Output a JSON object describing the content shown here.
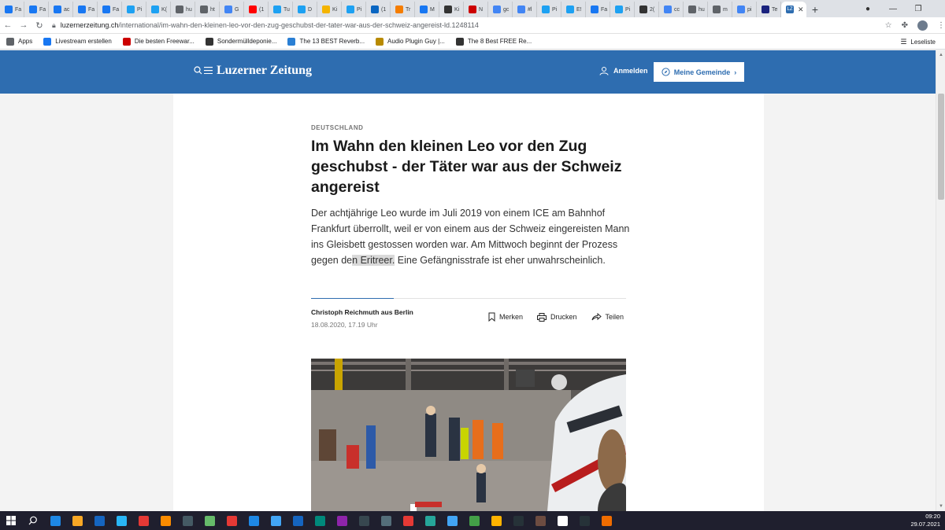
{
  "browser": {
    "tabs": [
      {
        "label": "Fa",
        "icon": "facebook-icon",
        "color": "#1877f2"
      },
      {
        "label": "Fa",
        "icon": "facebook-icon",
        "color": "#1877f2"
      },
      {
        "label": "ac",
        "icon": "facebook-icon",
        "color": "#1877f2"
      },
      {
        "label": "Fa",
        "icon": "facebook-icon",
        "color": "#1877f2"
      },
      {
        "label": "Fa",
        "icon": "facebook-icon",
        "color": "#1877f2"
      },
      {
        "label": "Pi",
        "icon": "twitter-icon",
        "color": "#1da1f2"
      },
      {
        "label": "K(",
        "icon": "twitter-icon",
        "color": "#1da1f2"
      },
      {
        "label": "hu",
        "icon": "globe-icon",
        "color": "#5f6368"
      },
      {
        "label": "ht",
        "icon": "globe-icon",
        "color": "#5f6368"
      },
      {
        "label": "G",
        "icon": "translate-icon",
        "color": "#4285f4"
      },
      {
        "label": "(1",
        "icon": "youtube-icon",
        "color": "#ff0000"
      },
      {
        "label": "Tu",
        "icon": "twitter-icon",
        "color": "#1da1f2"
      },
      {
        "label": "D",
        "icon": "twitter-icon",
        "color": "#1da1f2"
      },
      {
        "label": "Ki",
        "icon": "bookmark-icon",
        "color": "#f4b400"
      },
      {
        "label": "Pi",
        "icon": "twitter-icon",
        "color": "#1da1f2"
      },
      {
        "label": "(1",
        "icon": "linkedin-icon",
        "color": "#0a66c2"
      },
      {
        "label": "Tr",
        "icon": "blogger-icon",
        "color": "#f57d00"
      },
      {
        "label": "M",
        "icon": "facebook-icon",
        "color": "#1877f2"
      },
      {
        "label": "Ki",
        "icon": "wikipedia-icon",
        "color": "#333333"
      },
      {
        "label": "N",
        "icon": "zalando-icon",
        "color": "#cc0000"
      },
      {
        "label": "gc",
        "icon": "google-icon",
        "color": "#4285f4"
      },
      {
        "label": "#l",
        "icon": "google-icon",
        "color": "#4285f4"
      },
      {
        "label": "Pi",
        "icon": "twitter-icon",
        "color": "#1da1f2"
      },
      {
        "label": "E!",
        "icon": "twitter-icon",
        "color": "#1da1f2"
      },
      {
        "label": "Fa",
        "icon": "facebook-icon",
        "color": "#1877f2"
      },
      {
        "label": "Pi",
        "icon": "twitter-icon",
        "color": "#1da1f2"
      },
      {
        "label": "2(",
        "icon": "wikipedia-icon",
        "color": "#333333"
      },
      {
        "label": "cc",
        "icon": "google-icon",
        "color": "#4285f4"
      },
      {
        "label": "hu",
        "icon": "globe-icon",
        "color": "#5f6368"
      },
      {
        "label": "m",
        "icon": "globe-icon",
        "color": "#5f6368"
      },
      {
        "label": "pi",
        "icon": "google-icon",
        "color": "#4285f4"
      },
      {
        "label": "Te",
        "icon": "cross-icon",
        "color": "#1a237e"
      }
    ],
    "active_tab": {
      "label": "LZ",
      "color": "#2e6db0"
    },
    "url_host": "luzernerzeitung.ch",
    "url_path": "/international/im-wahn-den-kleinen-leo-vor-den-zug-geschubst-der-tater-war-aus-der-schweiz-angereist-ld.1248114",
    "bookmarks": [
      {
        "label": "Apps",
        "icon": "apps-grid-icon",
        "color": "#5f6368"
      },
      {
        "label": "Livestream erstellen",
        "icon": "facebook-icon",
        "color": "#1877f2"
      },
      {
        "label": "Die besten Freewar...",
        "icon": "star-icon",
        "color": "#cc0000"
      },
      {
        "label": "Sondermülldeponie...",
        "icon": "wikipedia-icon",
        "color": "#333333"
      },
      {
        "label": "The 13 BEST Reverb...",
        "icon": "wave-icon",
        "color": "#2a7fd4"
      },
      {
        "label": "Audio Plugin Guy |...",
        "icon": "plugin-icon",
        "color": "#b88a00"
      },
      {
        "label": "The 8 Best FREE Re...",
        "icon": "moon-icon",
        "color": "#333333"
      }
    ],
    "reading_list": "Leseliste"
  },
  "site": {
    "brand": "Luzerner Zeitung",
    "login": "Anmelden",
    "community_button": "Meine Gemeinde",
    "header_color": "#2e6db0"
  },
  "article": {
    "kicker": "DEUTSCHLAND",
    "headline": "Im Wahn den kleinen Leo vor den Zug geschubst - der Täter war aus der Schweiz angereist",
    "lead_before": "Der achtjährige Leo wurde im Juli 2019 von einem ICE am Bahnhof Frankfurt überrollt, weil er von einem aus der Schweiz eingereisten Mann ins Gleisbett gestossen worden war. Am Mittwoch beginnt der Prozess gegen de",
    "lead_highlight": "n Eritreer.",
    "lead_after": " Eine Gefängnisstrafe ist eher unwahrscheinlich.",
    "author": "Christoph Reichmuth aus Berlin",
    "date": "18.08.2020, 17.19 Uhr",
    "actions": {
      "save": "Merken",
      "print": "Drucken",
      "share": "Teilen"
    }
  },
  "taskbar": {
    "time": "09:20",
    "date": "29.07.2021"
  }
}
